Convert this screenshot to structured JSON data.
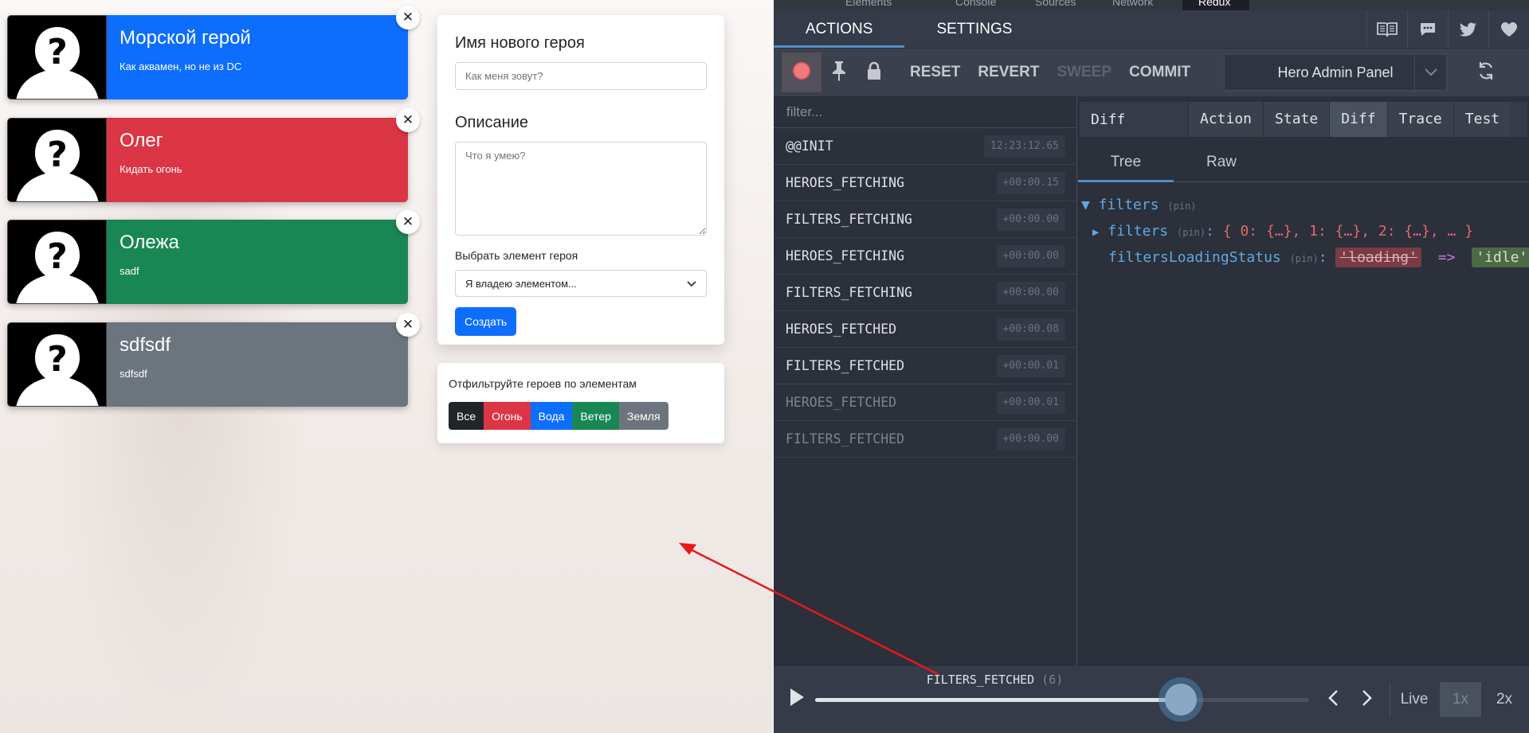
{
  "heroes": [
    {
      "name": "Морской герой",
      "description": "Как аквамен, но не из DC",
      "color": "#0d6efd"
    },
    {
      "name": "Олег",
      "description": "Кидать огонь",
      "color": "#dc3545"
    },
    {
      "name": "Олежа",
      "description": "sadf",
      "color": "#198754"
    },
    {
      "name": "sdfsdf",
      "description": "sdfsdf",
      "color": "#6c757d"
    }
  ],
  "form": {
    "name_label": "Имя нового героя",
    "name_placeholder": "Как меня зовут?",
    "desc_label": "Описание",
    "desc_placeholder": "Что я умею?",
    "element_label": "Выбрать элемент героя",
    "element_selected": "Я владею элементом...",
    "submit": "Создать"
  },
  "filters": {
    "title": "Отфильтруйте героев по элементам",
    "buttons": [
      {
        "label": "Все",
        "color": "#212529"
      },
      {
        "label": "Огонь",
        "color": "#dc3545"
      },
      {
        "label": "Вода",
        "color": "#0d6efd"
      },
      {
        "label": "Ветер",
        "color": "#198754"
      },
      {
        "label": "Земля",
        "color": "#6c757d"
      }
    ]
  },
  "devtools": {
    "top_tabs": [
      "Elements",
      "Console",
      "Sources",
      "Network",
      "Redux"
    ],
    "main_tabs": [
      "ACTIONS",
      "SETTINGS"
    ],
    "commands": {
      "reset": "RESET",
      "revert": "REVERT",
      "sweep": "SWEEP",
      "commit": "COMMIT"
    },
    "instance": "Hero Admin Panel",
    "filter_placeholder": "filter...",
    "actions": [
      {
        "type": "@@INIT",
        "time": "12:23:12.65",
        "skipped": false
      },
      {
        "type": "HEROES_FETCHING",
        "time": "+00:00.15",
        "skipped": false
      },
      {
        "type": "FILTERS_FETCHING",
        "time": "+00:00.00",
        "skipped": false
      },
      {
        "type": "HEROES_FETCHING",
        "time": "+00:00.00",
        "skipped": false
      },
      {
        "type": "FILTERS_FETCHING",
        "time": "+00:00.00",
        "skipped": false
      },
      {
        "type": "HEROES_FETCHED",
        "time": "+00:00.08",
        "skipped": false
      },
      {
        "type": "FILTERS_FETCHED",
        "time": "+00:00.01",
        "skipped": false
      },
      {
        "type": "HEROES_FETCHED",
        "time": "+00:00.01",
        "skipped": true
      },
      {
        "type": "FILTERS_FETCHED",
        "time": "+00:00.00",
        "skipped": true
      }
    ],
    "inspector": {
      "label": "Diff",
      "tabs": [
        "Action",
        "State",
        "Diff",
        "Trace",
        "Test"
      ],
      "active_tab": "Diff",
      "sub_tabs": [
        "Tree",
        "Raw"
      ],
      "tree": {
        "root_key": "filters",
        "pin": "(pin)",
        "child_key": "filters",
        "child_value": "{ 0: {…}, 1: {…}, 2: {…}, … }",
        "status_key": "filtersLoadingStatus",
        "old_value": "'loading'",
        "arrow": "=>",
        "new_value": "'idle'"
      }
    },
    "slider": {
      "label": "FILTERS_FETCHED",
      "count": "(6)",
      "position": 0.74,
      "speeds": [
        "Live",
        "1x",
        "2x"
      ],
      "active_speed": "1x"
    }
  }
}
